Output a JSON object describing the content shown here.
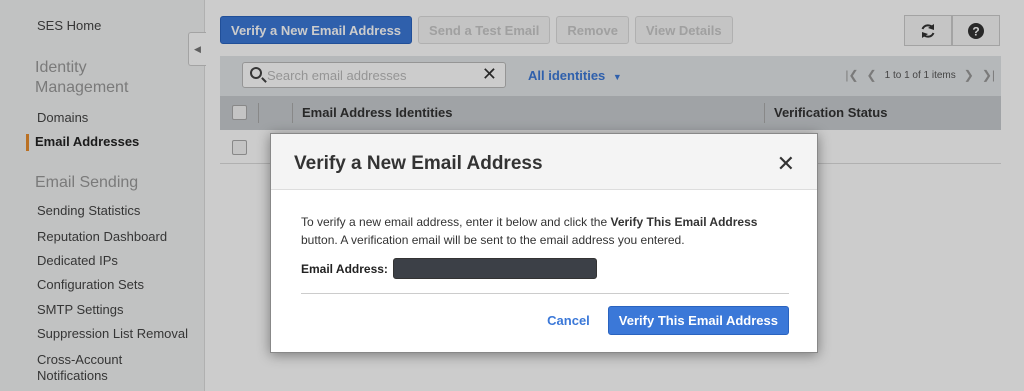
{
  "sidebar": {
    "home": "SES Home",
    "section_identity": "Identity Management",
    "domains": "Domains",
    "email_addresses": "Email Addresses",
    "section_sending": "Email Sending",
    "items": [
      "Sending Statistics",
      "Reputation Dashboard",
      "Dedicated IPs",
      "Configuration Sets",
      "SMTP Settings",
      "Suppression List Removal",
      "Cross-Account Notifications"
    ],
    "collapse_icon": "chevron-left-icon"
  },
  "toolbar": {
    "verify_new": "Verify a New Email Address",
    "send_test": "Send a Test Email",
    "remove": "Remove",
    "view_details": "View Details",
    "refresh_icon": "refresh-icon",
    "help_icon": "help-icon"
  },
  "filter": {
    "search_placeholder": "Search email addresses",
    "identities_filter": "All identities",
    "pager_text": "1 to 1 of 1 items"
  },
  "table": {
    "columns": [
      "Email Address Identities",
      "Verification Status"
    ]
  },
  "modal": {
    "title": "Verify a New Email Address",
    "body_pre": "To verify a new email address, enter it below and click the ",
    "body_bold": "Verify This Email Address",
    "body_post": " button. A verification email will be sent to the email address you entered.",
    "email_label": "Email Address:",
    "email_value": "",
    "cancel": "Cancel",
    "verify": "Verify This Email Address"
  },
  "colors": {
    "accent": "#3b78d8",
    "active_marker": "#e98c2c"
  }
}
